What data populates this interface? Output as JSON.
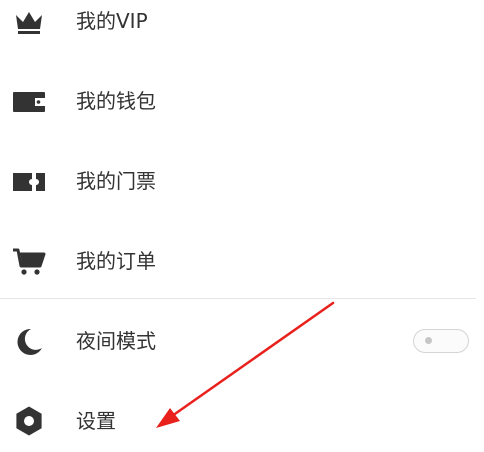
{
  "menu": {
    "items": [
      {
        "label": "我的VIP",
        "icon": "crown-icon"
      },
      {
        "label": "我的钱包",
        "icon": "wallet-icon"
      },
      {
        "label": "我的门票",
        "icon": "ticket-icon"
      },
      {
        "label": "我的订单",
        "icon": "cart-icon"
      },
      {
        "label": "夜间模式",
        "icon": "moon-icon"
      },
      {
        "label": "设置",
        "icon": "gear-icon"
      }
    ],
    "night_mode_enabled": false
  },
  "colors": {
    "icon": "#333333",
    "text": "#333333",
    "divider": "#e6e6e6",
    "toggle_border": "#d4d4d4",
    "annotation_arrow": "#e8211c"
  }
}
